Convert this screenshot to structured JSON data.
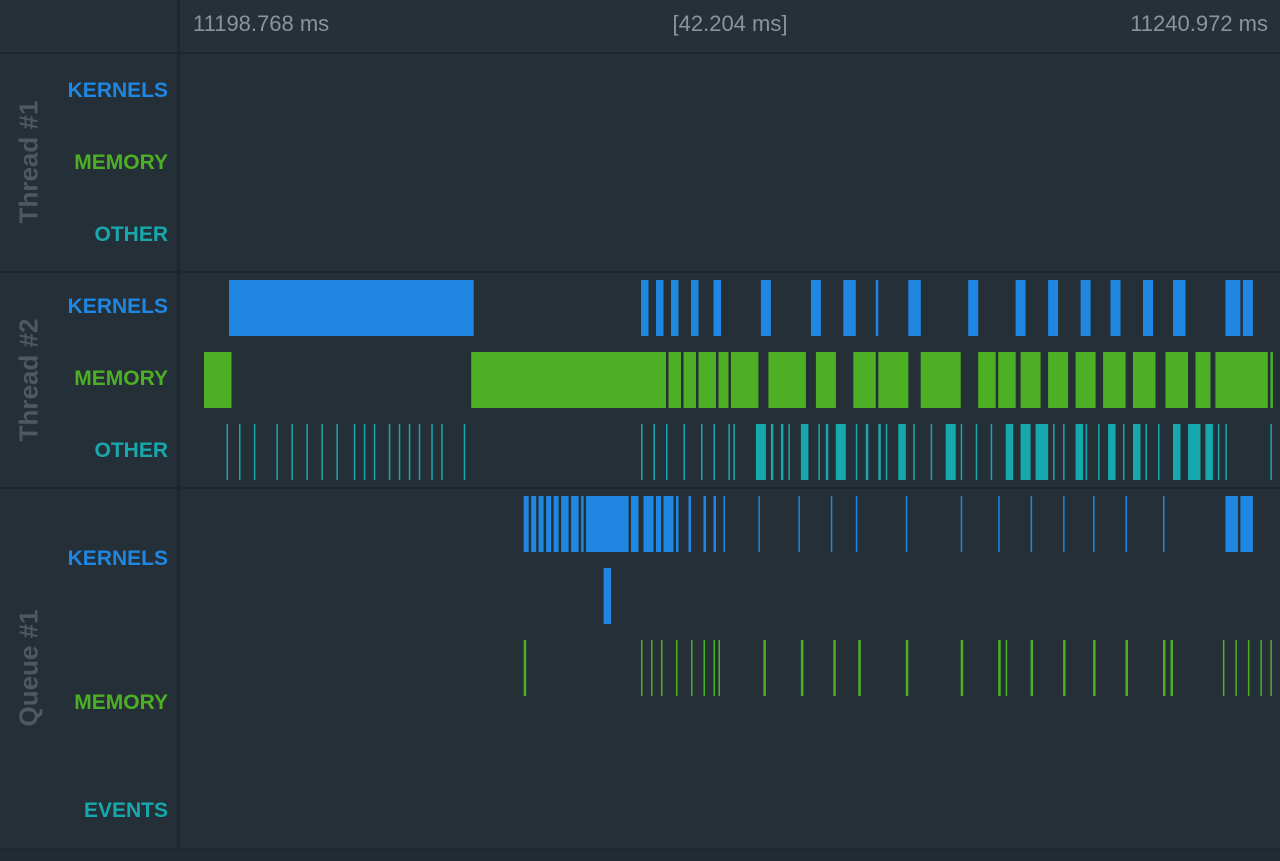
{
  "ruler": {
    "start": "11198.768 ms",
    "span": "[42.204 ms]",
    "end": "11240.972 ms"
  },
  "colors": {
    "kernels": "#1f86e1",
    "memory": "#4caf24",
    "other": "#17a8ad",
    "events": "#17a8ad"
  },
  "groups": [
    {
      "name": "Thread #1",
      "rows": {
        "kernels": "KERNELS",
        "memory": "MEMORY",
        "other": "OTHER"
      }
    },
    {
      "name": "Thread #2",
      "rows": {
        "kernels": "KERNELS",
        "memory": "MEMORY",
        "other": "OTHER"
      }
    },
    {
      "name": "Queue #1",
      "rows": {
        "kernels": "KERNELS",
        "memory": "MEMORY",
        "events": "EVENTS"
      }
    }
  ],
  "tracks": [
    {
      "id": "t2-kernels",
      "color": "kernels",
      "events": [
        [
          1.2,
          9.8
        ],
        [
          17.7,
          0.3
        ],
        [
          18.3,
          0.3
        ],
        [
          18.9,
          0.3
        ],
        [
          19.7,
          0.3
        ],
        [
          20.6,
          0.3
        ],
        [
          22.5,
          0.4
        ],
        [
          24.5,
          0.4
        ],
        [
          25.8,
          0.5
        ],
        [
          27.1,
          0.1
        ],
        [
          28.4,
          0.5
        ],
        [
          30.8,
          0.4
        ],
        [
          32.7,
          0.4
        ],
        [
          34.0,
          0.4
        ],
        [
          35.3,
          0.4
        ],
        [
          36.5,
          0.4
        ],
        [
          37.8,
          0.4
        ],
        [
          39.0,
          0.5
        ],
        [
          41.1,
          0.6
        ],
        [
          41.8,
          0.4
        ]
      ]
    },
    {
      "id": "t2-memory",
      "color": "memory",
      "events": [
        [
          0.2,
          1.1
        ],
        [
          10.9,
          7.8
        ],
        [
          18.8,
          0.5
        ],
        [
          19.4,
          0.5
        ],
        [
          20.0,
          0.7
        ],
        [
          20.8,
          0.4
        ],
        [
          21.3,
          1.1
        ],
        [
          22.8,
          1.5
        ],
        [
          24.7,
          0.8
        ],
        [
          26.2,
          0.9
        ],
        [
          27.2,
          1.2
        ],
        [
          28.9,
          1.6
        ],
        [
          31.2,
          0.7
        ],
        [
          32.0,
          0.7
        ],
        [
          32.9,
          0.8
        ],
        [
          34.0,
          0.8
        ],
        [
          35.1,
          0.8
        ],
        [
          36.2,
          0.9
        ],
        [
          37.4,
          0.9
        ],
        [
          38.7,
          0.9
        ],
        [
          39.9,
          0.6
        ],
        [
          40.7,
          2.1
        ],
        [
          42.9,
          0.1
        ]
      ]
    },
    {
      "id": "t2-other",
      "color": "other",
      "events": [
        [
          1.1,
          0.06
        ],
        [
          1.6,
          0.06
        ],
        [
          2.2,
          0.06
        ],
        [
          3.1,
          0.06
        ],
        [
          3.7,
          0.06
        ],
        [
          4.3,
          0.06
        ],
        [
          4.9,
          0.06
        ],
        [
          5.5,
          0.06
        ],
        [
          6.2,
          0.06
        ],
        [
          6.6,
          0.06
        ],
        [
          7.0,
          0.06
        ],
        [
          7.6,
          0.06
        ],
        [
          8.0,
          0.06
        ],
        [
          8.4,
          0.06
        ],
        [
          8.8,
          0.06
        ],
        [
          9.3,
          0.06
        ],
        [
          9.7,
          0.06
        ],
        [
          10.6,
          0.06
        ],
        [
          17.7,
          0.06
        ],
        [
          18.2,
          0.06
        ],
        [
          18.7,
          0.06
        ],
        [
          19.4,
          0.06
        ],
        [
          20.1,
          0.06
        ],
        [
          20.6,
          0.06
        ],
        [
          21.2,
          0.06
        ],
        [
          21.4,
          0.06
        ],
        [
          22.3,
          0.4
        ],
        [
          22.9,
          0.1
        ],
        [
          23.3,
          0.1
        ],
        [
          23.6,
          0.06
        ],
        [
          24.1,
          0.3
        ],
        [
          24.8,
          0.06
        ],
        [
          25.1,
          0.1
        ],
        [
          25.5,
          0.4
        ],
        [
          26.3,
          0.06
        ],
        [
          26.7,
          0.1
        ],
        [
          27.2,
          0.1
        ],
        [
          27.5,
          0.06
        ],
        [
          28.0,
          0.3
        ],
        [
          28.6,
          0.06
        ],
        [
          29.3,
          0.06
        ],
        [
          29.9,
          0.4
        ],
        [
          30.5,
          0.06
        ],
        [
          31.1,
          0.06
        ],
        [
          31.7,
          0.06
        ],
        [
          32.3,
          0.3
        ],
        [
          32.9,
          0.4
        ],
        [
          33.5,
          0.5
        ],
        [
          34.2,
          0.06
        ],
        [
          34.6,
          0.06
        ],
        [
          35.1,
          0.3
        ],
        [
          35.5,
          0.06
        ],
        [
          36.0,
          0.06
        ],
        [
          36.4,
          0.3
        ],
        [
          37.0,
          0.06
        ],
        [
          37.4,
          0.3
        ],
        [
          37.9,
          0.06
        ],
        [
          38.4,
          0.06
        ],
        [
          39.0,
          0.3
        ],
        [
          39.6,
          0.5
        ],
        [
          40.3,
          0.3
        ],
        [
          40.8,
          0.06
        ],
        [
          41.1,
          0.06
        ],
        [
          42.9,
          0.06
        ]
      ]
    },
    {
      "id": "q1-kernels",
      "color": "kernels",
      "events": [
        [
          13.0,
          0.2
        ],
        [
          13.3,
          0.2
        ],
        [
          13.6,
          0.2
        ],
        [
          13.9,
          0.2
        ],
        [
          14.2,
          0.2
        ],
        [
          14.5,
          0.3
        ],
        [
          14.9,
          0.3
        ],
        [
          15.3,
          0.1
        ],
        [
          15.5,
          1.7
        ],
        [
          17.3,
          0.3
        ],
        [
          17.8,
          0.4
        ],
        [
          18.3,
          0.2
        ],
        [
          18.6,
          0.4
        ],
        [
          19.1,
          0.1
        ],
        [
          19.6,
          0.1
        ],
        [
          20.2,
          0.1
        ],
        [
          20.6,
          0.1
        ],
        [
          21.0,
          0.06
        ],
        [
          22.4,
          0.06
        ],
        [
          24.0,
          0.06
        ],
        [
          25.3,
          0.06
        ],
        [
          26.3,
          0.06
        ],
        [
          28.3,
          0.06
        ],
        [
          30.5,
          0.06
        ],
        [
          32.0,
          0.06
        ],
        [
          33.3,
          0.06
        ],
        [
          34.6,
          0.06
        ],
        [
          35.8,
          0.06
        ],
        [
          37.1,
          0.06
        ],
        [
          38.6,
          0.06
        ],
        [
          41.1,
          0.5
        ],
        [
          41.7,
          0.5
        ]
      ]
    },
    {
      "id": "q1-kernels-2",
      "color": "kernels",
      "events": [
        [
          16.2,
          0.3
        ]
      ]
    },
    {
      "id": "q1-memory",
      "color": "memory",
      "events": [
        [
          13.0,
          0.1
        ],
        [
          17.7,
          0.06
        ],
        [
          18.1,
          0.06
        ],
        [
          18.5,
          0.06
        ],
        [
          19.1,
          0.06
        ],
        [
          19.7,
          0.06
        ],
        [
          20.2,
          0.06
        ],
        [
          20.6,
          0.06
        ],
        [
          20.8,
          0.06
        ],
        [
          22.6,
          0.1
        ],
        [
          24.1,
          0.1
        ],
        [
          25.4,
          0.1
        ],
        [
          26.4,
          0.1
        ],
        [
          28.3,
          0.1
        ],
        [
          30.5,
          0.1
        ],
        [
          32.0,
          0.1
        ],
        [
          32.3,
          0.06
        ],
        [
          33.3,
          0.1
        ],
        [
          34.6,
          0.1
        ],
        [
          35.8,
          0.1
        ],
        [
          37.1,
          0.1
        ],
        [
          38.6,
          0.1
        ],
        [
          38.9,
          0.1
        ],
        [
          41.0,
          0.06
        ],
        [
          41.5,
          0.06
        ],
        [
          42.0,
          0.06
        ],
        [
          42.5,
          0.06
        ],
        [
          42.9,
          0.06
        ]
      ]
    }
  ]
}
